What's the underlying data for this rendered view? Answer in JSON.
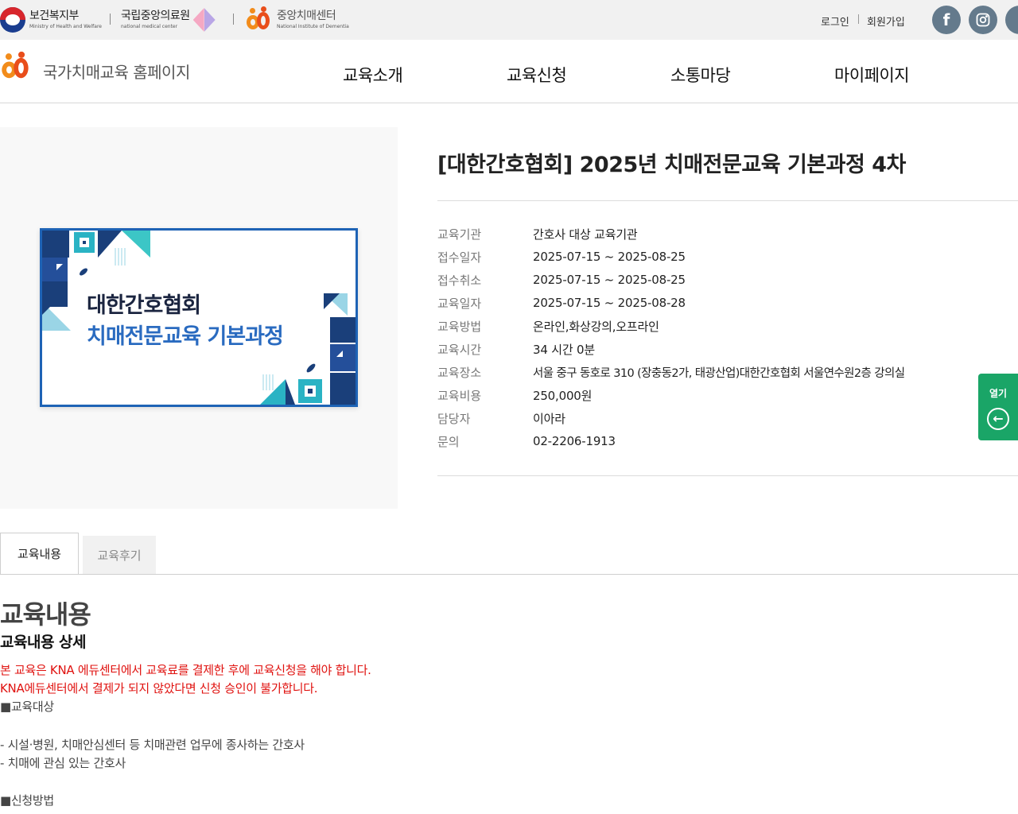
{
  "topbar": {
    "orgs": [
      {
        "kr": "보건복지부",
        "en": "Ministry of Health and Welfare"
      },
      {
        "kr": "국립중앙의료원",
        "en": "national medical center"
      },
      {
        "kr": "중앙치매센터",
        "en": "National Institute of Dementia"
      }
    ],
    "login": "로그인",
    "signup": "회원가입",
    "facebook_glyph": "f"
  },
  "header": {
    "site_title": "국가치매교육 홈페이지",
    "nav": [
      "교육소개",
      "교육신청",
      "소통마당",
      "마이페이지"
    ]
  },
  "thumbnail": {
    "line1": "대한간호협회",
    "line2": "치매전문교육 기본과정"
  },
  "course": {
    "title": "[대한간호협회] 2025년 치매전문교육 기본과정 4차",
    "info": [
      {
        "label": "교육기관",
        "value": "간호사 대상 교육기관"
      },
      {
        "label": "접수일자",
        "value": "2025-07-15 ~ 2025-08-25"
      },
      {
        "label": "접수취소",
        "value": "2025-07-15 ~ 2025-08-25"
      },
      {
        "label": "교육일자",
        "value": "2025-07-15 ~ 2025-08-28"
      },
      {
        "label": "교육방법",
        "value": "온라인,화상강의,오프라인"
      },
      {
        "label": "교육시간",
        "value": "34 시간 0분"
      },
      {
        "label": "교육장소",
        "value": "서울 중구 동호로 310 (장충동2가, 태광산업)대한간호협회 서울연수원2층 강의실"
      },
      {
        "label": "교육비용",
        "value": "250,000원"
      },
      {
        "label": "담당자",
        "value": "이아라"
      },
      {
        "label": "문의",
        "value": "02-2206-1913"
      }
    ]
  },
  "side_button": {
    "label": "열기",
    "icon": "arrow-left-icon",
    "glyph": "←"
  },
  "tabs": [
    "교육내용",
    "교육후기"
  ],
  "content": {
    "heading": "교육내용",
    "subheading": "교육내용 상세",
    "notice_lines": [
      "본 교육은 KNA 에듀센터에서 교육료를 결제한 후에 교육신청을 해야 합니다.",
      "KNA에듀센터에서 결제가 되지 않았다면 신청 승인이 불가합니다."
    ],
    "section_target": "■교육대상",
    "target_items": [
      "- 시설·병원, 치매안심센터 등 치매관련 업무에 종사하는 간호사",
      "- 치매에 관심 있는 간호사"
    ],
    "section_apply": "■신청방법"
  },
  "colors": {
    "accent_green": "#1aa567",
    "notice_red": "#e0120f",
    "thumb_border": "#1e63b5",
    "sns_gray": "#647a8c"
  }
}
